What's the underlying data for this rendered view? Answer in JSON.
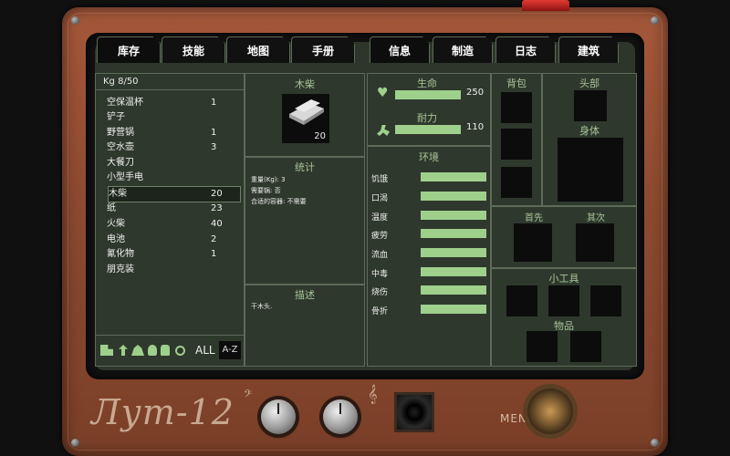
{
  "tabs": [
    "库存",
    "技能",
    "地图",
    "手册",
    "信息",
    "制造",
    "日志",
    "建筑"
  ],
  "inventory": {
    "header": "Kg 8/50",
    "items": [
      {
        "name": "空保温杯",
        "qty": "1"
      },
      {
        "name": "铲子",
        "qty": ""
      },
      {
        "name": "野营锅",
        "qty": "1"
      },
      {
        "name": "空水壶",
        "qty": "3"
      },
      {
        "name": "大餐刀",
        "qty": ""
      },
      {
        "name": "小型手电",
        "qty": ""
      },
      {
        "name": "木柴",
        "qty": "20"
      },
      {
        "name": "纸",
        "qty": "23"
      },
      {
        "name": "火柴",
        "qty": "40"
      },
      {
        "name": "电池",
        "qty": "2"
      },
      {
        "name": "氰化物",
        "qty": "1"
      },
      {
        "name": "朋克装",
        "qty": ""
      }
    ],
    "filter_all": "ALL",
    "filter_sort": "A-Z"
  },
  "detail": {
    "title": "木柴",
    "count": "20",
    "stats_title": "统计",
    "stats_lines": [
      "重量(Kg): 3",
      "需要锅: 否",
      "合适的容器: 不需要"
    ],
    "desc_title": "描述",
    "desc_text": "干木头."
  },
  "vitals": {
    "life_label": "生命",
    "life_value": "250",
    "stamina_label": "耐力",
    "stamina_value": "110"
  },
  "environment": {
    "title": "环境",
    "rows": [
      "饥饿",
      "口渴",
      "温度",
      "疲劳",
      "流血",
      "中毒",
      "烧伤",
      "骨折"
    ]
  },
  "equipment": {
    "backpack": "背包",
    "head": "头部",
    "body": "身体",
    "primary": "首先",
    "secondary": "其次",
    "gadgets": "小工具",
    "items": "物品"
  },
  "device": {
    "brand": "Лут-12",
    "menu": "MENU"
  }
}
